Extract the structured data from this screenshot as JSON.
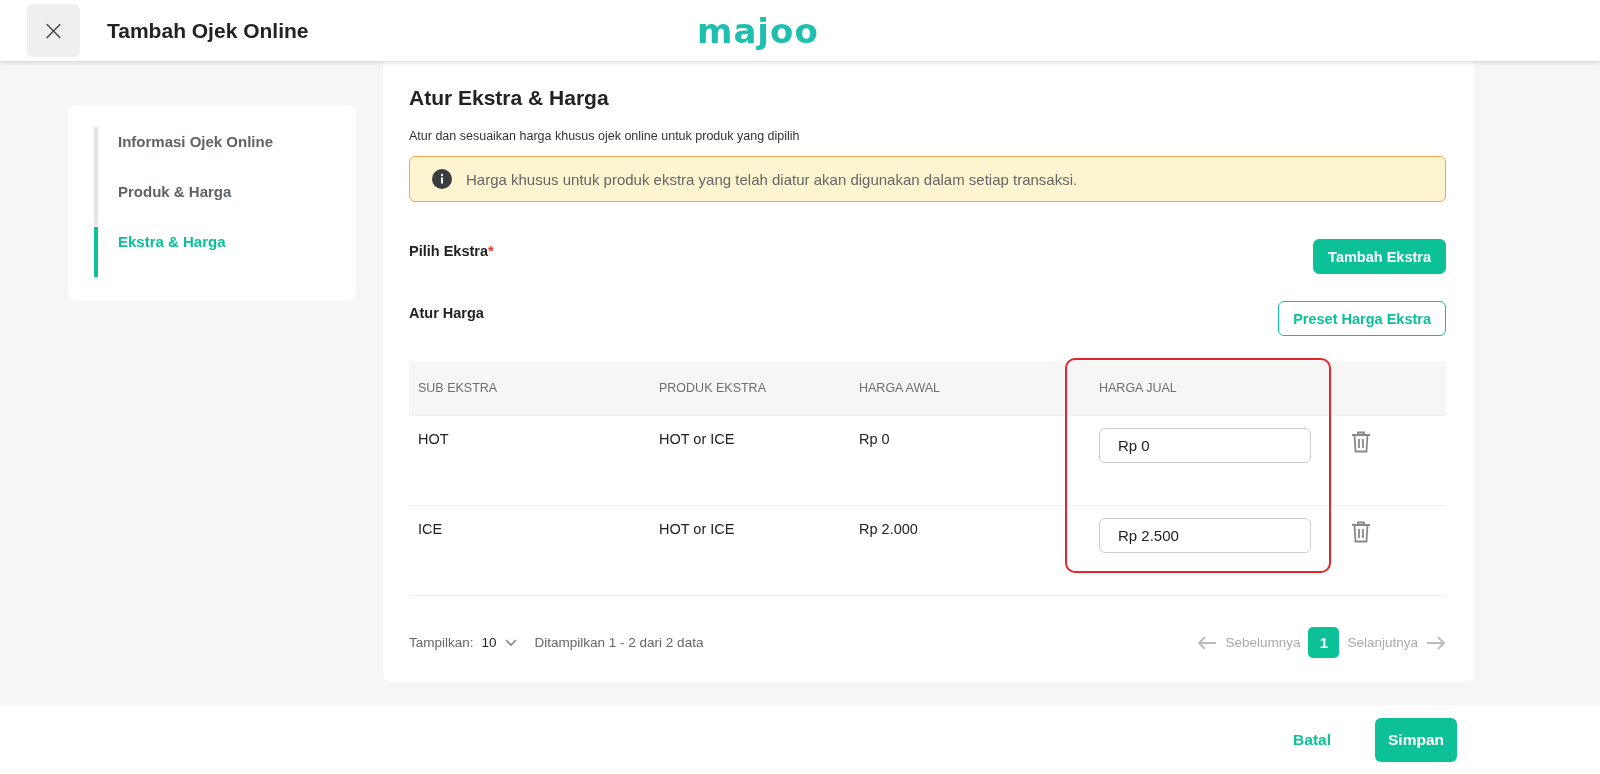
{
  "header": {
    "close_label": "×",
    "title": "Tambah Ojek Online",
    "logo": "majoo"
  },
  "steps": [
    {
      "label": "Informasi Ojek Online",
      "selected": false
    },
    {
      "label": "Produk & Harga",
      "selected": false
    },
    {
      "label": "Ekstra & Harga",
      "selected": true
    }
  ],
  "section": {
    "title": "Atur Ekstra & Harga",
    "description": "Atur dan sesuaikan harga khusus ojek online untuk produk yang dipilih",
    "info": "Harga khusus untuk produk ekstra yang telah diatur akan digunakan dalam setiap transaksi."
  },
  "pick_extra": {
    "label": "Pilih Ekstra",
    "required_mark": "*",
    "button": "Tambah Ekstra"
  },
  "set_price": {
    "label": "Atur Harga",
    "button": "Preset Harga Ekstra"
  },
  "table": {
    "columns": [
      {
        "label": "SUB EKSTRA",
        "highlighted": false
      },
      {
        "label": "PRODUK EKSTRA",
        "highlighted": false
      },
      {
        "label": "HARGA AWAL",
        "highlighted": false
      },
      {
        "label": "HARGA JUAL",
        "highlighted": true
      }
    ],
    "rows": [
      {
        "sub": "HOT",
        "product": "HOT or ICE",
        "base_price": "Rp 0",
        "sell_price": "Rp 0"
      },
      {
        "sub": "ICE",
        "product": "HOT or ICE",
        "base_price": "Rp 2.000",
        "sell_price": "Rp 2.500"
      }
    ]
  },
  "pagination": {
    "show_label": "Tampilkan:",
    "page_size": "10",
    "summary": "Ditampilkan 1 - 2 dari 2 data",
    "prev": "Sebelumnya",
    "pages": [
      {
        "label": "1",
        "selected": true
      }
    ],
    "next": "Selanjutnya"
  },
  "footer": {
    "cancel": "Batal",
    "save": "Simpan"
  }
}
